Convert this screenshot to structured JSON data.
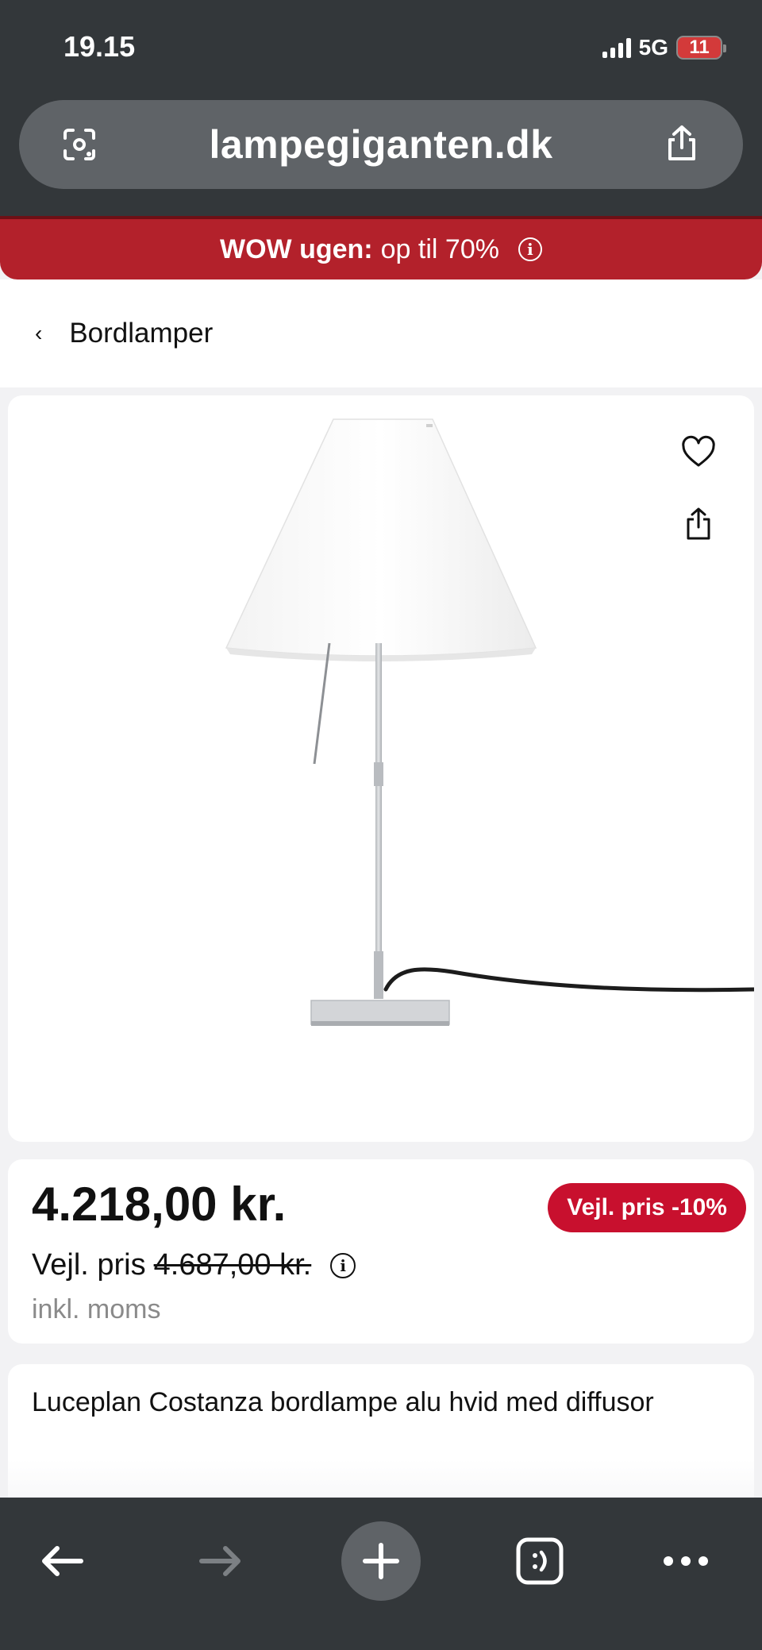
{
  "status_bar": {
    "time": "19.15",
    "network": "5G",
    "battery": "11"
  },
  "browser": {
    "url": "lampegiganten.dk",
    "left_icon": "lens-camera-icon",
    "right_icon": "share-icon"
  },
  "promo": {
    "bold_text": "WOW ugen:",
    "text": "op til 70%",
    "info_icon": "info-icon",
    "color": "#b3212b"
  },
  "breadcrumb": {
    "back_icon": "chevron-left-icon",
    "label": "Bordlamper"
  },
  "product_image": {
    "description_icon": "table-lamp-image",
    "favorite_icon": "heart-icon",
    "share_icon": "share-icon"
  },
  "price": {
    "current": "4.218,00 kr.",
    "rrp_label": "Vejl. pris",
    "rrp_value": "4.687,00 kr.",
    "vat_note": "inkl. moms",
    "badge": "Vejl. pris -10%",
    "badge_color": "#c8102e"
  },
  "product": {
    "title": "Luceplan Costanza bordlampe alu hvid med diffusor"
  },
  "bottom_nav": {
    "back_icon": "arrow-left-icon",
    "forward_icon": "arrow-right-icon",
    "new_tab_icon": "plus-icon",
    "tabs_icon": "tab-switcher-icon",
    "more_icon": "more-dots-icon"
  }
}
